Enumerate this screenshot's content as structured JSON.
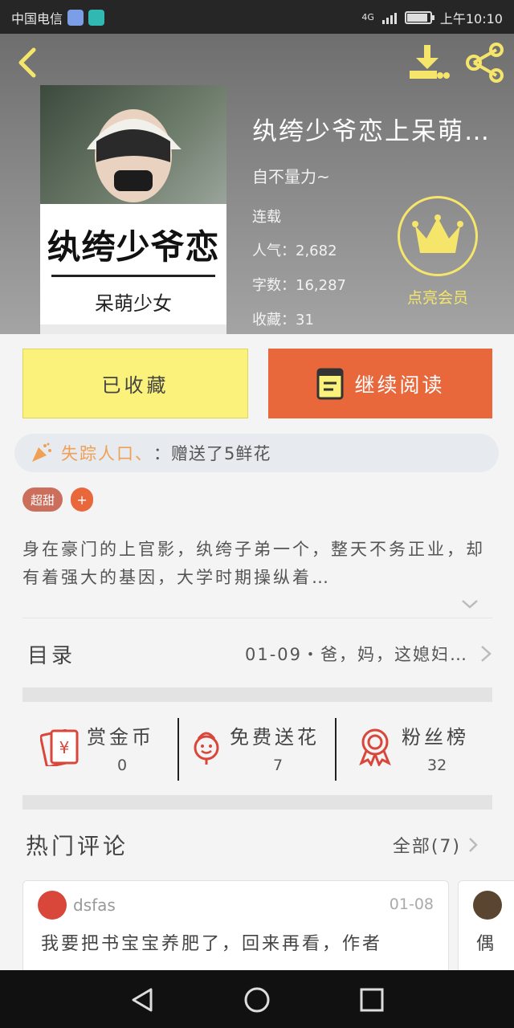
{
  "status_bar": {
    "carrier": "中国电信",
    "network": "4G",
    "time": "上午10:10",
    "battery_level": 0.9,
    "signal_bars": 4
  },
  "header": {
    "book_title": "纨绔少爷恋上呆萌…",
    "author": "自不量力~",
    "status": "连载",
    "popularity_label": "人气：",
    "popularity": "2,682",
    "word_count_label": "字数：",
    "word_count": "16,287",
    "favorites_label": "收藏：",
    "favorites": "31",
    "vip_label": "点亮会员",
    "cover": {
      "title_text": "纨绔少爷恋",
      "author_text": "呆萌少女"
    }
  },
  "actions": {
    "favorited_label": "已收藏",
    "continue_label": "继续阅读"
  },
  "gift": {
    "user": "失踪人口、",
    "text": "：赠送了5鲜花"
  },
  "tags": [
    "超甜"
  ],
  "tag_add": "+",
  "synopsis": "身在豪门的上官影，纨绔子弟一个，整天不务正业，却有着强大的基因，大学时期操纵着…",
  "toc": {
    "label": "目录",
    "latest": "01-09・爸，妈，这媳妇…"
  },
  "stats": [
    {
      "label": "赏金币",
      "value": "0",
      "icon": "red-envelope-icon"
    },
    {
      "label": "免费送花",
      "value": "7",
      "icon": "flower-icon"
    },
    {
      "label": "粉丝榜",
      "value": "32",
      "icon": "rank-medal-icon"
    }
  ],
  "comments": {
    "title": "热门评论",
    "all_label": "全部(7)",
    "items": [
      {
        "user": "dsfas",
        "date": "01-08",
        "text": "我要把书宝宝养肥了，回来再看，作者"
      },
      {
        "text": "偶"
      }
    ]
  },
  "colors": {
    "accent_orange": "#e8683c",
    "fav_yellow": "#fbf27c",
    "vip_yellow": "#f5e66b",
    "header_gray": "#8c8c8c"
  }
}
